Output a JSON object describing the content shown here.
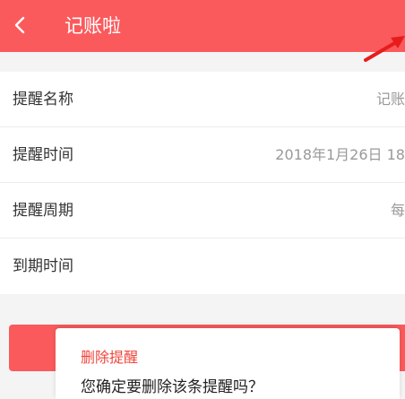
{
  "header": {
    "title": "记账啦",
    "back_icon": "chevron-left-icon",
    "background": "#fb5a5c"
  },
  "form": {
    "rows": [
      {
        "label": "提醒名称",
        "value": "记账"
      },
      {
        "label": "提醒时间",
        "value": "2018年1月26日 18"
      },
      {
        "label": "提醒周期",
        "value": "每"
      },
      {
        "label": "到期时间",
        "value": ""
      }
    ]
  },
  "annotation": {
    "icon": "red-arrow-icon",
    "color": "#e81c1c"
  },
  "dialog": {
    "title": "删除提醒",
    "message": "您确定要删除该条提醒吗？",
    "title_color": "#f0453b"
  },
  "action_button": {
    "color": "#fb5a5c"
  }
}
